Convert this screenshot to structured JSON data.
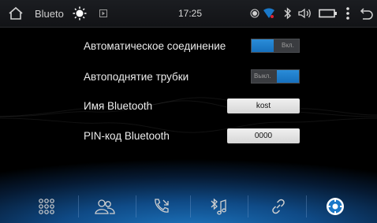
{
  "status_bar": {
    "title": "Blueto",
    "time": "17:25",
    "icons": [
      "home-icon",
      "brightness-icon",
      "media-icon",
      "location-icon",
      "wifi-icon",
      "bluetooth-icon",
      "volume-icon",
      "battery-icon",
      "more-icon",
      "back-icon"
    ]
  },
  "settings": {
    "auto_connect": {
      "label": "Автоматическое соединение",
      "state_text": "Вкл.",
      "on": true
    },
    "auto_answer": {
      "label": "Автоподнятие трубки",
      "state_text": "Выкл.",
      "on": false
    },
    "bt_name": {
      "label": "Имя Bluetooth",
      "value": "kost"
    },
    "bt_pin": {
      "label": "PIN-код Bluetooth",
      "value": "0000"
    }
  },
  "bottom_nav": [
    "dialpad-icon",
    "contacts-icon",
    "call-log-icon",
    "music-icon",
    "link-icon",
    "settings-icon"
  ],
  "colors": {
    "accent": "#1a78c8",
    "background": "#000000",
    "field_bg": "#e6e6e6"
  }
}
